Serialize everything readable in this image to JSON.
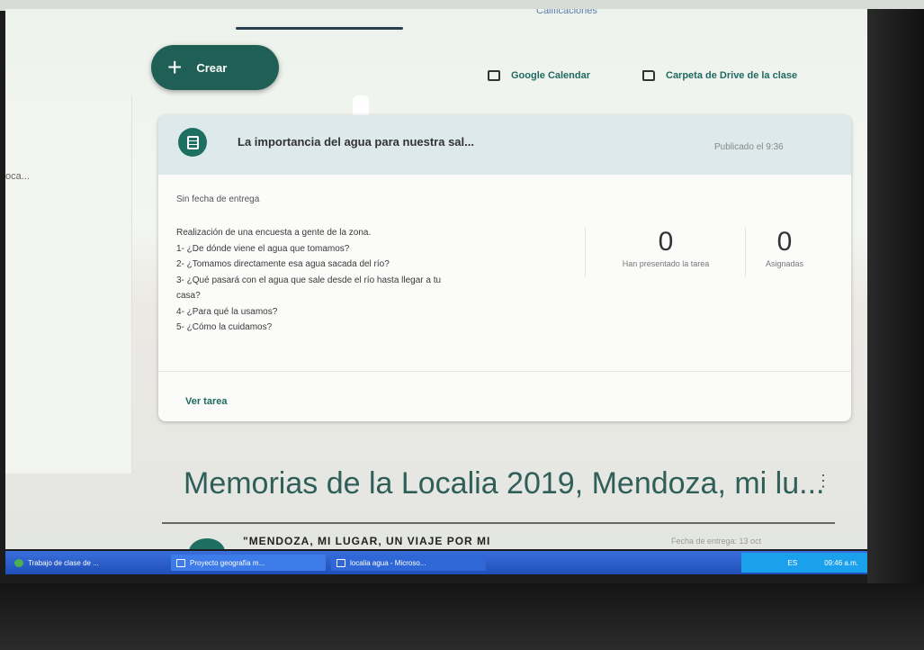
{
  "header": {
    "top_tab_partial": "Calificaciones",
    "create_label": "Crear",
    "calendar_label": "Google Calendar",
    "drive_label": "Carpeta de Drive de la clase"
  },
  "sidebar": {
    "item_partial": "oca..."
  },
  "assignment": {
    "title": "La importancia del agua para nuestra sal...",
    "published": "Publicado el 9:36",
    "due": "Sin fecha de entrega",
    "description": [
      "Realización de una encuesta a gente de la zona.",
      "1- ¿De dónde viene el agua que tomamos?",
      "2- ¿Tomamos directamente esa agua sacada del río?",
      "3- ¿Qué pasará con el agua que sale desde el río hasta llegar a tu",
      "casa?",
      "4- ¿Para qué la usamos?",
      "5- ¿Cómo la cuidamos?"
    ],
    "stat_submitted": {
      "value": "0",
      "label": "Han presentado la tarea"
    },
    "stat_assigned": {
      "value": "0",
      "label": "Asignadas"
    },
    "view_label": "Ver tarea"
  },
  "topic": {
    "title": "Memorias de la Localia 2019, Mendoza, mi lu...",
    "more": "⋮",
    "next_item": "\"MENDOZA, MI LUGAR, UN VIAJE POR MI",
    "next_date": "Fecha de entrega: 13 oct"
  },
  "taskbar": {
    "tasks": [
      "Trabajo de clase de ...",
      "Proyecto geografía m...",
      "localia agua - Microso..."
    ],
    "tray_lang": "ES",
    "tray_time": "09:46 a.m."
  },
  "colors": {
    "accent": "#1f6b60",
    "create_bg": "#1f5f55",
    "taskbar": "#2a5fcf"
  }
}
